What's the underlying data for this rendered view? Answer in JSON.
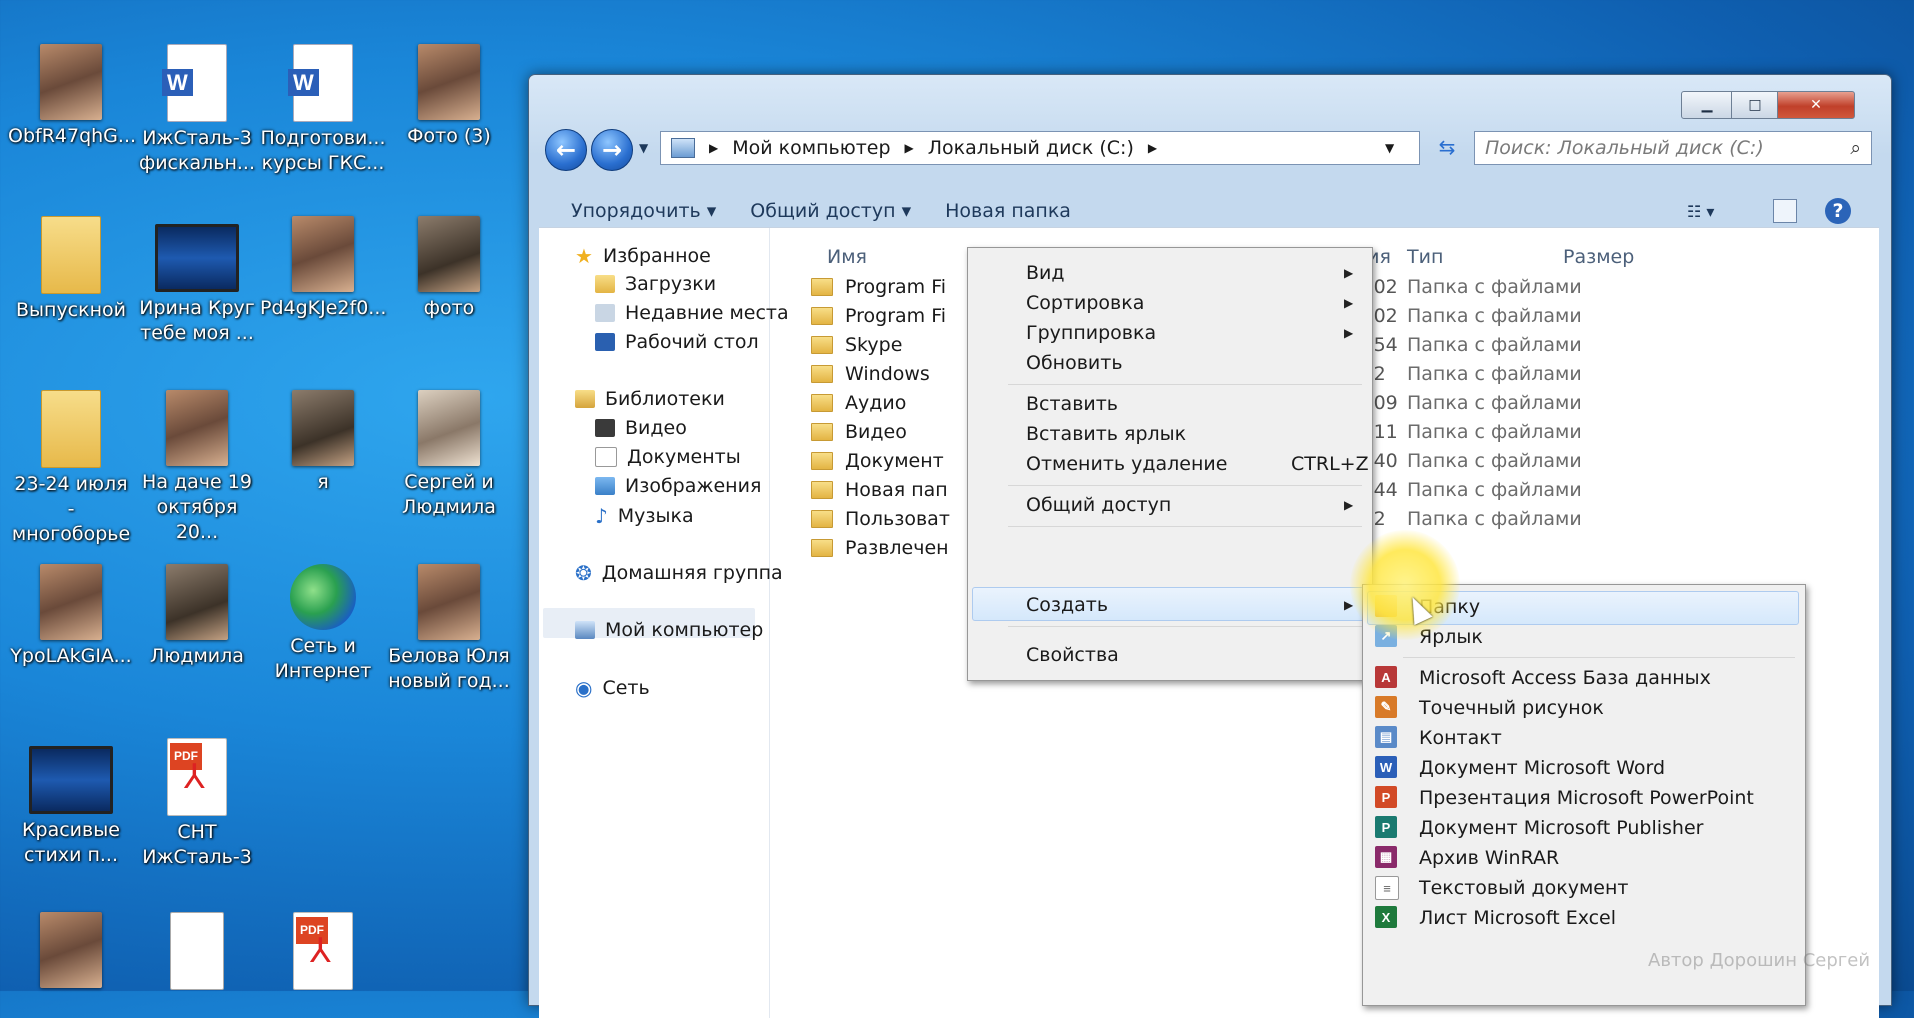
{
  "desktop": {
    "icons": [
      {
        "label": "ObfR47qhG...",
        "kind": "photo"
      },
      {
        "label": "ИжСталь-3 фискальн...",
        "kind": "doc"
      },
      {
        "label": "Подготови... курсы ГКС...",
        "kind": "doc"
      },
      {
        "label": "Фото (3)",
        "kind": "photo"
      },
      {
        "label": "Выпускной",
        "kind": "folder"
      },
      {
        "label": "Ирина Круг тебе моя ...",
        "kind": "video"
      },
      {
        "label": "Pd4gKJe2f0...",
        "kind": "photo"
      },
      {
        "label": "фото",
        "kind": "photo"
      },
      {
        "label": "23-24 июля - многоборье",
        "kind": "folder"
      },
      {
        "label": "На даче 19 октября 20...",
        "kind": "photo"
      },
      {
        "label": "я",
        "kind": "photo"
      },
      {
        "label": "Сергей и Людмила",
        "kind": "photo"
      },
      {
        "label": "YpoLAkGIA...",
        "kind": "photo"
      },
      {
        "label": "Людмила",
        "kind": "photo"
      },
      {
        "label": "Сеть и Интернет",
        "kind": "net"
      },
      {
        "label": "Белова Юля новый год...",
        "kind": "photo"
      },
      {
        "label": "Красивые стихи п...",
        "kind": "video"
      },
      {
        "label": "СНТ ИжСталь-3",
        "kind": "pdf"
      }
    ]
  },
  "window": {
    "controls": {
      "min": "▁",
      "max": "□",
      "close": "✕"
    },
    "nav": {
      "back": "←",
      "forward": "→"
    },
    "address": {
      "crumbs": [
        "Мой компьютер",
        "Локальный диск (C:)"
      ]
    },
    "search": {
      "placeholder": "Поиск: Локальный диск (C:)"
    },
    "toolbar": {
      "organize": "Упорядочить",
      "share": "Общий доступ",
      "new_folder": "Новая папка"
    },
    "sidebar": {
      "favorites": "Избранное",
      "downloads": "Загрузки",
      "recent": "Недавние места",
      "desktop": "Рабочий стол",
      "libraries": "Библиотеки",
      "video": "Видео",
      "documents": "Документы",
      "images": "Изображения",
      "music": "Музыка",
      "homegroup": "Домашняя группа",
      "computer": "Мой компьютер",
      "network": "Сеть"
    },
    "columns": {
      "name": "Имя",
      "date": "ения",
      "type": "Тип",
      "size": "Размер"
    },
    "files": [
      {
        "name": "Program Fi",
        "time": "21:02",
        "type": "Папка с файлами"
      },
      {
        "name": "Program Fi",
        "time": "21:02",
        "type": "Папка с файлами"
      },
      {
        "name": "Skype",
        "time": "19:54",
        "type": "Папка с файлами"
      },
      {
        "name": "Windows",
        "time": "8:32",
        "type": "Папка с файлами"
      },
      {
        "name": "Аудио",
        "time": "16:09",
        "type": "Папка с файлами"
      },
      {
        "name": "Видео",
        "time": "16:11",
        "type": "Папка с файлами"
      },
      {
        "name": "Документ",
        "time": "19:40",
        "type": "Папка с файлами"
      },
      {
        "name": "Новая пап",
        "time": "14:44",
        "type": "Папка с файлами"
      },
      {
        "name": "Пользоват",
        "time": "1:22",
        "type": "Папка с файлами"
      },
      {
        "name": "Развлечен",
        "time": "",
        "type": ""
      }
    ]
  },
  "context_menu": {
    "view": "Вид",
    "sort": "Сортировка",
    "group": "Группировка",
    "refresh": "Обновить",
    "paste": "Вставить",
    "paste_shortcut": "Вставить ярлык",
    "undo_delete": "Отменить удаление",
    "undo_shortcut": "CTRL+Z",
    "share": "Общий доступ",
    "create": "Создать",
    "properties": "Свойства"
  },
  "submenu": {
    "folder": "Папку",
    "shortcut": "Ярлык",
    "access": "Microsoft Access База данных",
    "bitmap": "Точечный рисунок",
    "contact": "Контакт",
    "word": "Документ Microsoft Word",
    "powerpoint": "Презентация Microsoft PowerPoint",
    "publisher": "Документ Microsoft Publisher",
    "winrar": "Архив WinRAR",
    "text": "Текстовый документ",
    "excel": "Лист Microsoft Excel"
  },
  "watermark": "Автор Дорошин Сергей",
  "colors": {
    "accent": "#1a86d8",
    "highlight": "#d5e8fb"
  }
}
